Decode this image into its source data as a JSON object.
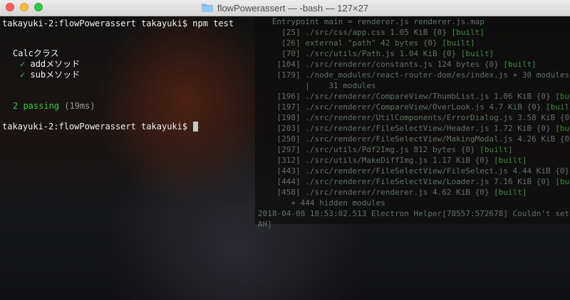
{
  "window": {
    "title": "flowPowerassert — -bash — 127×27"
  },
  "terminal": {
    "prompt1": "takayuki-2:flowPowerassert takayuki$ npm test",
    "suite": "Calcクラス",
    "tests": [
      {
        "check": "✓",
        "name": "addメソッド"
      },
      {
        "check": "✓",
        "name": "subメソッド"
      }
    ],
    "passing": "2 passing",
    "duration": "(19ms)",
    "prompt2": "takayuki-2:flowPowerassert takayuki$"
  },
  "background_terminal": {
    "lines": [
      {
        "text": "   Entrypoint main = renderer.js renderer.js.map",
        "tag": ""
      },
      {
        "text": "     [25] ./src/css/app.css 1.05 KiB {0} ",
        "tag": "[built]"
      },
      {
        "text": "     [26] external \"path\" 42 bytes {0} ",
        "tag": "[built]"
      },
      {
        "text": "     [70] ./src/utils/Path.js 1.04 KiB {0} ",
        "tag": "[built]"
      },
      {
        "text": "    [104] ./src/renderer/constants.js 124 bytes {0} ",
        "tag": "[built]"
      },
      {
        "text": "    [179] ./node_modules/react-router-dom/es/index.js + 30 modules 75",
        "tag": ""
      },
      {
        "text": "          |    31 modules",
        "tag": ""
      },
      {
        "text": "    [196] ./src/renderer/CompareView/ThumbList.js 1.06 KiB {0} ",
        "tag": "[built]"
      },
      {
        "text": "    [197] ./src/renderer/CompareView/OverLook.js 4.7 KiB {0} ",
        "tag": "[built]"
      },
      {
        "text": "    [198] ./src/renderer/UtilComponents/ErrorDialog.js 3.58 KiB {0} ",
        "tag": "[b"
      },
      {
        "text": "    [203] ./src/renderer/FileSelectView/Header.js 1.72 KiB {0} ",
        "tag": "[built"
      },
      {
        "text": "    [250] ./src/renderer/FileSelectView/MakingModal.js 4.26 KiB {0} ",
        "tag": "[b"
      },
      {
        "text": "    [297] ./src/utils/Pdf2Img.js 812 bytes {0} ",
        "tag": "[built]"
      },
      {
        "text": "    [312] ./src/utils/MakeDiffImg.js 1.17 KiB {0} ",
        "tag": "[built]"
      },
      {
        "text": "    [443] ./src/renderer/FileSelectView/FileSelect.js 4.44 KiB {0} ",
        "tag": "[b"
      },
      {
        "text": "    [444] ./src/renderer/FileSelectView/Loader.js 7.16 KiB {0} ",
        "tag": "[bu"
      },
      {
        "text": "    [458] ./src/renderer/renderer.js 4.62 KiB {0} ",
        "tag": "[built]"
      },
      {
        "text": "       + 444 hidden modules",
        "tag": ""
      },
      {
        "text": "2018-04-08 18:53:02.513 Electron Helper[78557:572678] Couldn't set sel",
        "tag": ""
      },
      {
        "text": "AH]",
        "tag": ""
      }
    ]
  },
  "colors": {
    "pass_green": "#3ac83a",
    "close": "#fc605b",
    "minimize": "#fdbc40",
    "maximize": "#34c84a"
  }
}
